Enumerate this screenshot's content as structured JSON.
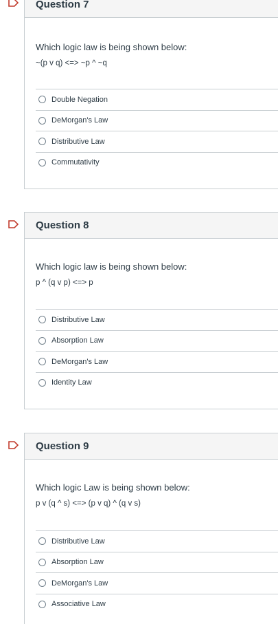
{
  "questions": [
    {
      "title": "Question 7",
      "prompt": "Which logic law is being shown below:",
      "formula": "~(p v q) <=> ~p ^ ~q",
      "answers": [
        "Double Negation",
        "DeMorgan's Law",
        "Distributive Law",
        "Commutativity"
      ]
    },
    {
      "title": "Question 8",
      "prompt": "Which logic law is being shown below:",
      "formula": "p ^ (q v p) <=> p",
      "answers": [
        "Distributive Law",
        "Absorption Law",
        "DeMorgan's Law",
        "Identity Law"
      ]
    },
    {
      "title": "Question 9",
      "prompt": "Which logic Law is being shown below:",
      "formula": "p v (q ^ s) <=> (p v q) ^ (q v s)",
      "answers": [
        "Distributive Law",
        "Absorption Law",
        "DeMorgan's Law",
        "Associative Law"
      ]
    }
  ],
  "colors": {
    "flag": "#c23c2d",
    "header_bg": "#f5f5f5",
    "border": "#c7cdd1",
    "text": "#2d3b45"
  }
}
